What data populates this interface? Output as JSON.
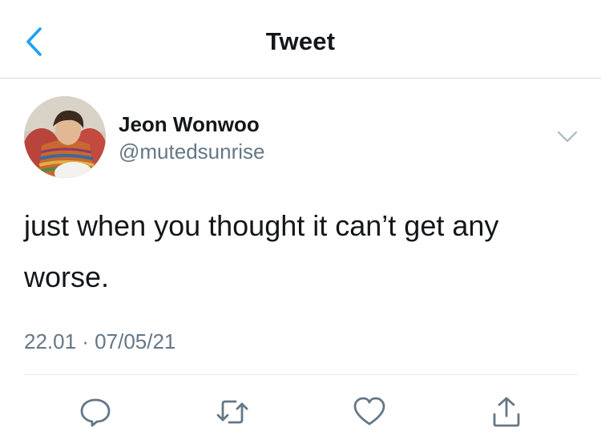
{
  "header": {
    "title": "Tweet",
    "back_icon": "chevron-left-icon",
    "accent_color": "#1da1f2"
  },
  "tweet": {
    "author_name": "Jeon Wonwoo",
    "handle": "@mutedsunrise",
    "text": "just when you thought it can’t get any worse.",
    "timestamp": "22.01 · 07/05/21",
    "more_icon": "chevron-down-icon"
  },
  "actions": [
    {
      "icon": "reply-icon"
    },
    {
      "icon": "retweet-icon"
    },
    {
      "icon": "heart-icon"
    },
    {
      "icon": "share-icon"
    }
  ],
  "colors": {
    "text_primary": "#14171a",
    "text_secondary": "#657786",
    "divider": "#e1e8ed"
  }
}
